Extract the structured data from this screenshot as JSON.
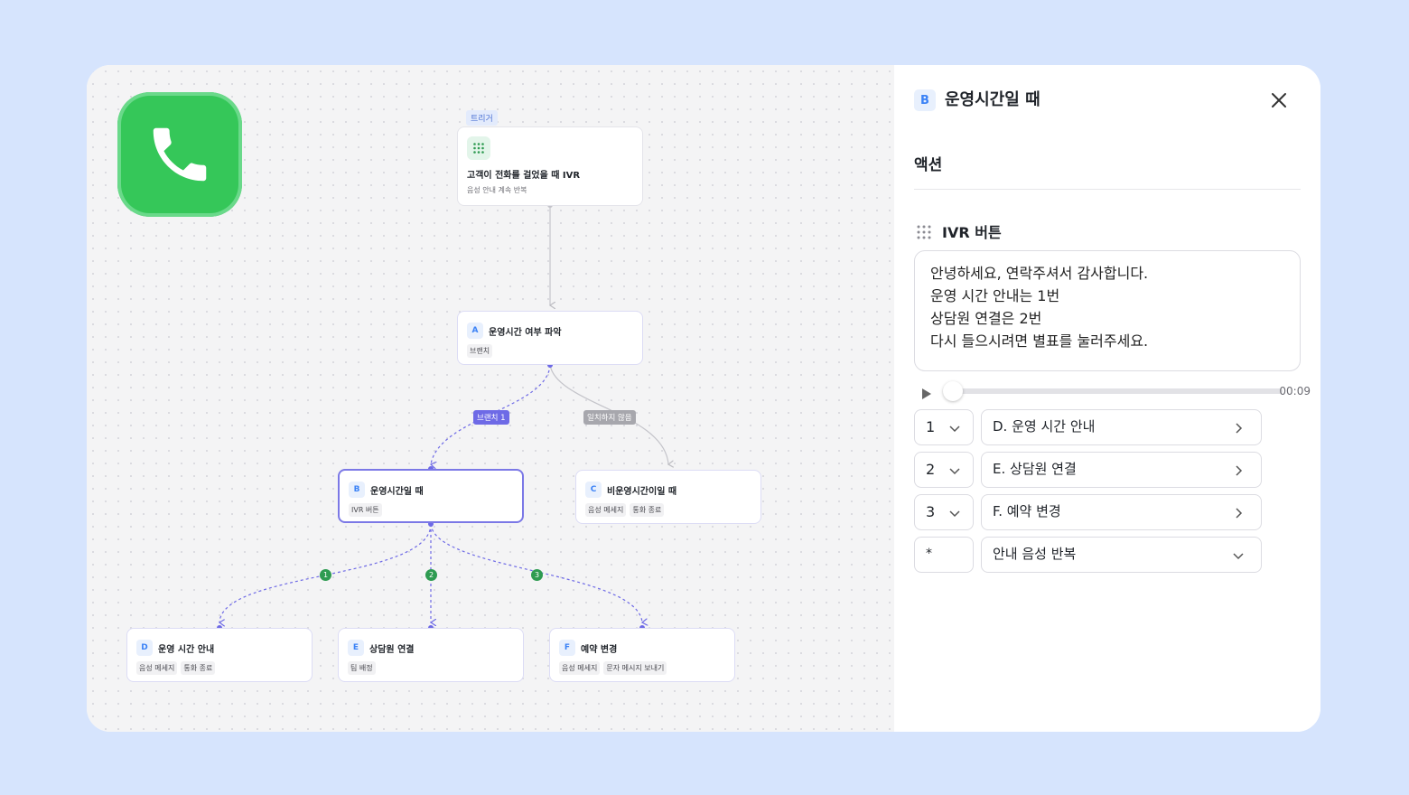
{
  "canvas": {
    "trigger": {
      "label": "트리거",
      "title": "고객이 전화를 걸었을 때 IVR",
      "subtitle": "음성 안내 계속 반복"
    },
    "nodes": [
      {
        "letter": "A",
        "title": "운영시간 여부 파악",
        "tags": [
          "브랜치"
        ]
      },
      {
        "letter": "B",
        "title": "운영시간일 때",
        "tags": [
          "IVR 버튼"
        ]
      },
      {
        "letter": "C",
        "title": "비운영시간이일 때",
        "tags": [
          "음성 메세지",
          "통화 종료"
        ]
      },
      {
        "letter": "D",
        "title": "운영 시간 안내",
        "tags": [
          "음성 메세지",
          "통화 종료"
        ]
      },
      {
        "letter": "E",
        "title": "상담원 연결",
        "tags": [
          "팀 배정"
        ]
      },
      {
        "letter": "F",
        "title": "예약 변경",
        "tags": [
          "음성 메세지",
          "문자 메시지 보내기"
        ]
      }
    ],
    "edge_labels": {
      "branch1": "브랜치 1",
      "no_match": "일치하지 않음",
      "n1": "1",
      "n2": "2",
      "n3": "3"
    }
  },
  "panel": {
    "badge": "B",
    "title": "운영시간일 때",
    "section": "액션",
    "subsection": "IVR 버튼",
    "message": "안녕하세요, 연락주셔서 감사합니다.\n운영 시간 안내는 1번\n상담원 연결은 2번\n다시 들으시려면 별표를 눌러주세요.",
    "audio": {
      "time": "00:09",
      "progress": 0.0
    },
    "rows": [
      {
        "key": "1",
        "target": "D. 운영 시간 안내"
      },
      {
        "key": "2",
        "target": "E. 상담원 연결"
      },
      {
        "key": "3",
        "target": "F. 예약 변경"
      },
      {
        "key": "*",
        "target": "안내 음성 반복"
      }
    ]
  },
  "colors": {
    "background": "#d6e4fd",
    "accent": "#6e6ae6",
    "app_icon": "#35c759",
    "edge_number": "#2e9b51",
    "letter_badge": "#3b82f6"
  }
}
